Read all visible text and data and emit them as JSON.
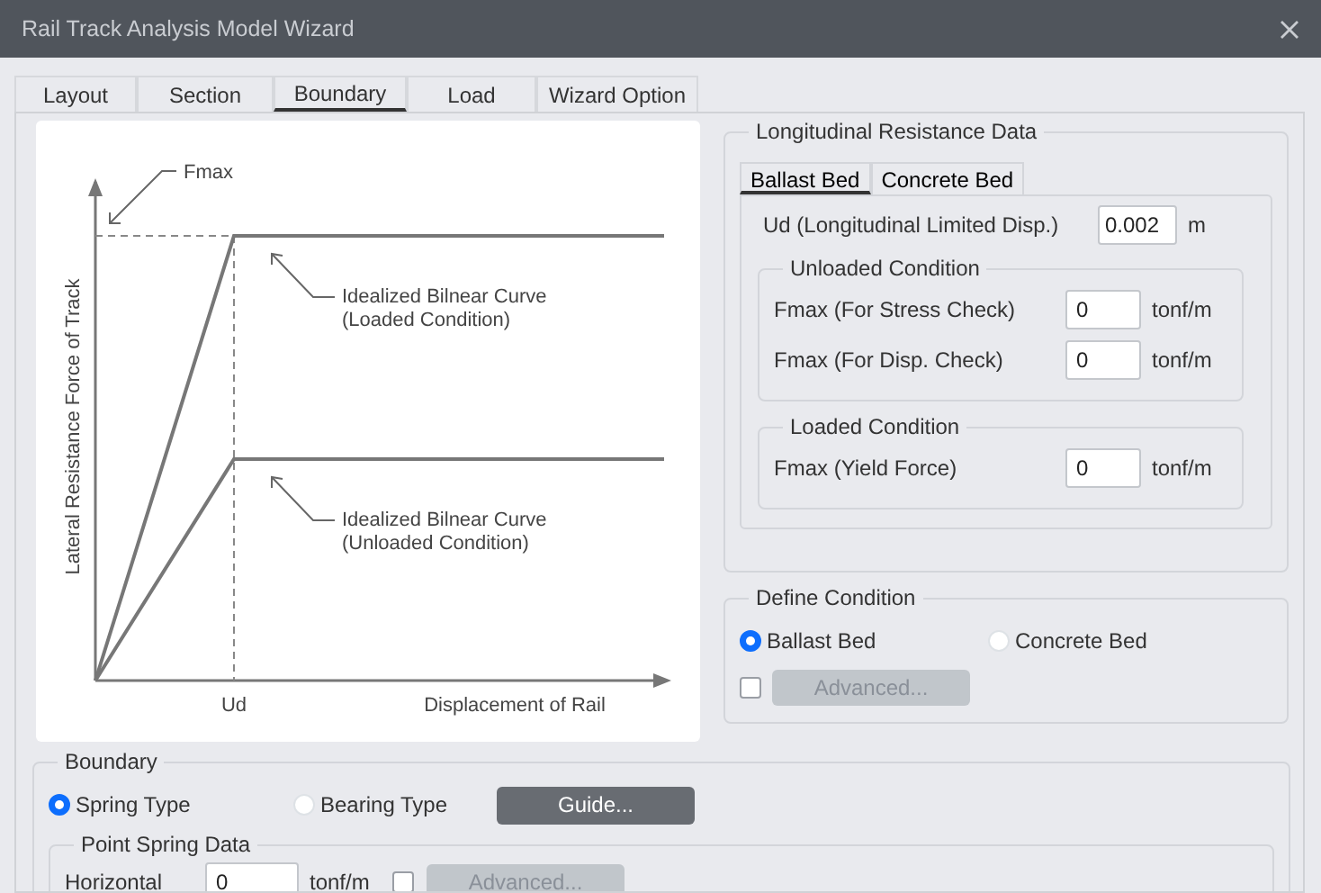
{
  "window": {
    "title": "Rail Track Analysis Model Wizard"
  },
  "tabs": [
    {
      "label": "Layout",
      "selected": false
    },
    {
      "label": "Section",
      "selected": false
    },
    {
      "label": "Boundary",
      "selected": true
    },
    {
      "label": "Load",
      "selected": false
    },
    {
      "label": "Wizard Option",
      "selected": false
    }
  ],
  "diagram": {
    "fmax_label": "Fmax",
    "y_axis_label": "Lateral Resistance Force of Track",
    "x_axis_label": "Displacement of Rail",
    "ud_label": "Ud",
    "curves": [
      {
        "line1": "Idealized Bilnear Curve",
        "line2": "(Loaded Condition)"
      },
      {
        "line1": "Idealized Bilnear Curve",
        "line2": "(Unloaded Condition)"
      }
    ]
  },
  "longitudinal_resistance": {
    "title": "Longitudinal Resistance Data",
    "tabs": [
      {
        "label": "Ballast Bed",
        "selected": true
      },
      {
        "label": "Concrete Bed",
        "selected": false
      }
    ],
    "ud": {
      "label": "Ud (Longitudinal Limited Disp.)",
      "value": "0.002",
      "unit": "m"
    },
    "groups": [
      {
        "title": "Unloaded Condition",
        "fields": [
          {
            "label": "Fmax (For Stress Check)",
            "value": "0",
            "unit": "tonf/m"
          },
          {
            "label": "Fmax (For Disp. Check)",
            "value": "0",
            "unit": "tonf/m"
          }
        ]
      },
      {
        "title": "Loaded Condition",
        "fields": [
          {
            "label": "Fmax (Yield Force)",
            "value": "0",
            "unit": "tonf/m"
          }
        ]
      }
    ]
  },
  "define_condition": {
    "title": "Define Condition",
    "options": [
      {
        "label": "Ballast Bed",
        "selected": true
      },
      {
        "label": "Concrete Bed",
        "selected": false
      }
    ],
    "advanced": {
      "checked": false,
      "label": "Advanced...",
      "disabled": true
    }
  },
  "boundary": {
    "title": "Boundary",
    "options": [
      {
        "label": "Spring Type",
        "selected": true
      },
      {
        "label": "Bearing Type",
        "selected": false
      }
    ],
    "guide_button": "Guide...",
    "point_spring": {
      "title": "Point Spring Data",
      "fields": [
        {
          "label": "Horizontal",
          "value": "0",
          "unit": "tonf/m",
          "checked": false,
          "advanced": "Advanced...",
          "disabled": true
        }
      ]
    }
  }
}
